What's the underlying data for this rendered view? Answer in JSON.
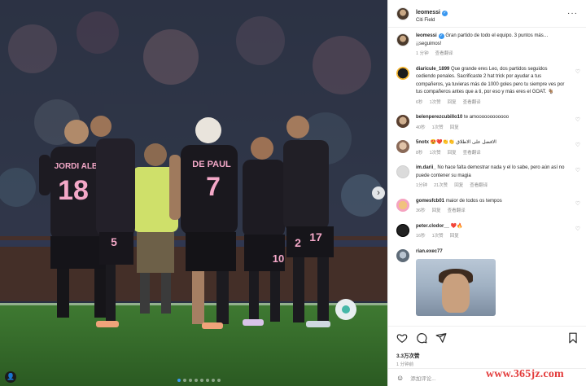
{
  "post": {
    "username": "leomessi",
    "location": "Citi Field",
    "caption": "Gran partido de todo el equipo. 3 puntos más… ¡¡seguimos!",
    "caption_time": "1 分钟",
    "caption_translate": "查看翻译"
  },
  "photo": {
    "jerseys": {
      "alba_name": "JORDI ALBA",
      "alba_number": "18",
      "depaul_name": "DE PAUL",
      "depaul_number": "7",
      "num_5": "5",
      "num_10": "10",
      "num_17": "17",
      "num_2": "2"
    }
  },
  "comments": [
    {
      "user": "diaricule_1899",
      "text": "Que grande eres Leo, dos partidos seguidos cediendo penales. Sacrificaste 2 hat trick por ayudar a tus compañeros, ya tuvieras más de 1000 goles pero tu siempre ves por tus compañeros antes que a ti, por eso y más eres el GOAT. 🐐",
      "time": "6秒",
      "likes": "1次赞",
      "reply": "回复",
      "translate": "查看翻译"
    },
    {
      "user": "belenperezcubillo10",
      "text": "te amoooooooooooo",
      "time": "40秒",
      "likes": "1次赞",
      "reply": "回复",
      "translate": ""
    },
    {
      "user": "5notx",
      "text": "😍❤️👏👏 الافضل على الاطلاق",
      "time": "8秒",
      "likes": "1次赞",
      "reply": "回复",
      "translate": "查看翻译"
    },
    {
      "user": "im.darii_",
      "text": "No hace falta demostrar nada y el lo sabe, pero aún así no puede contener su magia",
      "time": "1分钟",
      "likes": "21次赞",
      "reply": "回复",
      "translate": "查看翻译"
    },
    {
      "user": "gomesfcb01",
      "text": "maior de todos os tempos",
      "time": "36秒",
      "likes": "",
      "reply": "回复",
      "translate": "查看翻译"
    },
    {
      "user": "peter.clodor__",
      "text": "❤️🔥",
      "time": "16秒",
      "likes": "1次赞",
      "reply": "回复",
      "translate": ""
    },
    {
      "user": "rian.exec77",
      "text": "",
      "time": "",
      "likes": "",
      "reply": "",
      "translate": ""
    }
  ],
  "actions": {
    "likes": "3.3万次赞",
    "posted": "1 分钟前",
    "add_comment_placeholder": "添加评论..."
  },
  "watermark": "www.365jz.com",
  "icons": {
    "heart": "heart-icon",
    "comment": "comment-icon",
    "share": "share-icon",
    "save": "bookmark-icon",
    "emoji": "emoji-icon",
    "more": "more-icon",
    "verified": "verified-badge-icon"
  }
}
